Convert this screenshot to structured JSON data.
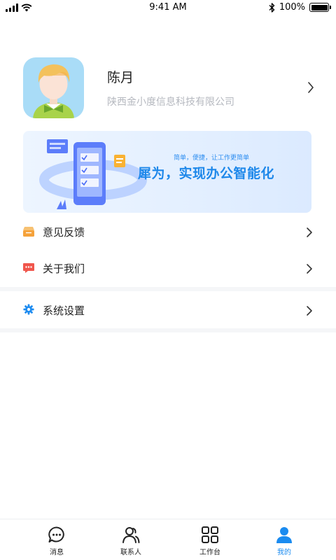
{
  "status_bar": {
    "time": "9:41 AM",
    "battery": "100%",
    "battery_level": 1.0
  },
  "profile": {
    "name": "陈月",
    "company": "陕西金小度信息科技有限公司",
    "avatar_icon": "user-avatar",
    "chevron_icon": "chevron-right-icon"
  },
  "banner": {
    "tagline": "简单，便捷，让工作更简单",
    "headline": "犀为，实现办公智能化"
  },
  "menu": {
    "items": [
      {
        "label": "意见反馈",
        "icon": "feedback-icon",
        "color": "#f5a23a"
      },
      {
        "label": "关于我们",
        "icon": "message-icon",
        "color": "#f0564c"
      },
      {
        "label": "系统设置",
        "icon": "gear-icon",
        "color": "#1e8cf0"
      }
    ]
  },
  "tabbar": {
    "tabs": [
      {
        "label": "消息",
        "icon": "chat-bubble-icon"
      },
      {
        "label": "联系人",
        "icon": "contacts-icon"
      },
      {
        "label": "工作台",
        "icon": "grid-icon"
      },
      {
        "label": "我的",
        "icon": "person-icon",
        "active": true
      }
    ],
    "active_color": "#1a8bf0"
  }
}
